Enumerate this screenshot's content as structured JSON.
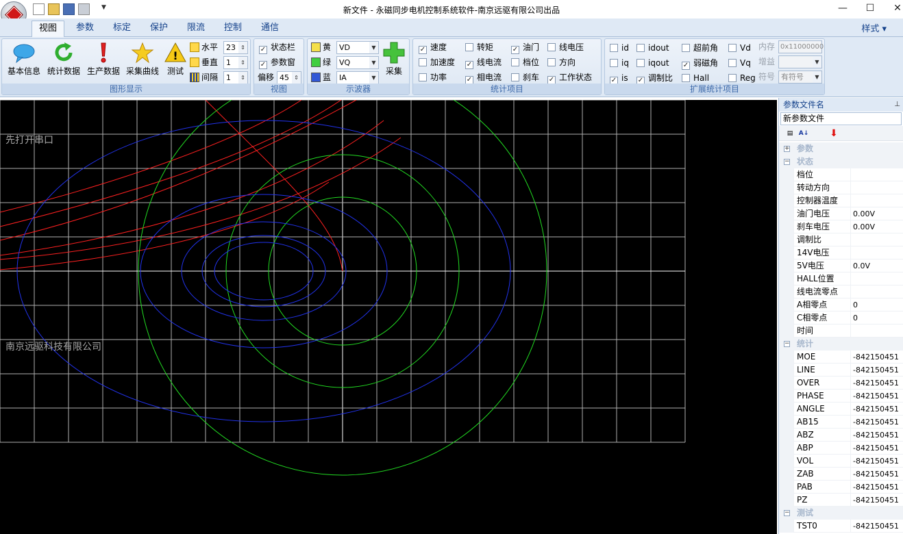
{
  "window": {
    "title": "新文件 - 永磁同步电机控制系统软件-南京远驱有限公司出品"
  },
  "tabs": [
    "视图",
    "参数",
    "标定",
    "保护",
    "限流",
    "控制",
    "通信"
  ],
  "style_menu": "样式",
  "groups": {
    "graph": {
      "label": "图形显示",
      "buttons": [
        "基本信息",
        "统计数据",
        "生产数据",
        "采集曲线",
        "测试"
      ],
      "spinners": [
        {
          "label": "水平",
          "value": "23"
        },
        {
          "label": "垂直",
          "value": "1"
        },
        {
          "label": "间隔",
          "value": "1"
        }
      ]
    },
    "view": {
      "label": "视图",
      "items": [
        {
          "label": "状态栏",
          "checked": true
        },
        {
          "label": "参数窗",
          "checked": true
        }
      ],
      "offset_label": "偏移",
      "offset_value": "45"
    },
    "scope": {
      "label": "示波器",
      "channels": [
        {
          "color_name": "黄",
          "color": "#f5e04a",
          "value": "VD"
        },
        {
          "color_name": "绿",
          "color": "#3fce3f",
          "value": "VQ"
        },
        {
          "color_name": "蓝",
          "color": "#3157d6",
          "value": "IA"
        }
      ],
      "capture_label": "采集"
    },
    "stats": {
      "label": "统计项目",
      "items": [
        {
          "label": "速度",
          "checked": true
        },
        {
          "label": "转矩",
          "checked": false
        },
        {
          "label": "油门",
          "checked": true
        },
        {
          "label": "线电压",
          "checked": false
        },
        {
          "label": "加速度",
          "checked": false
        },
        {
          "label": "线电流",
          "checked": true
        },
        {
          "label": "档位",
          "checked": false
        },
        {
          "label": "方向",
          "checked": false
        },
        {
          "label": "功率",
          "checked": false
        },
        {
          "label": "相电流",
          "checked": true
        },
        {
          "label": "刹车",
          "checked": false
        },
        {
          "label": "工作状态",
          "checked": true
        }
      ]
    },
    "ext": {
      "label": "扩展统计项目",
      "items": [
        {
          "label": "id",
          "checked": false
        },
        {
          "label": "idout",
          "checked": false
        },
        {
          "label": "超前角",
          "checked": false
        },
        {
          "label": "Vd",
          "checked": false
        },
        {
          "label": "iq",
          "checked": false
        },
        {
          "label": "iqout",
          "checked": false
        },
        {
          "label": "弱磁角",
          "checked": true
        },
        {
          "label": "Vq",
          "checked": false
        },
        {
          "label": "is",
          "checked": true
        },
        {
          "label": "调制比",
          "checked": true
        },
        {
          "label": "Hall",
          "checked": false
        },
        {
          "label": "Reg",
          "checked": false
        }
      ],
      "memory_label": "内存",
      "memory_value": "0x11000000",
      "gain_label": "增益",
      "gain_value": "",
      "sign_label": "符号",
      "sign_value": "有符号"
    }
  },
  "scope_view": {
    "text_top": "先打开串口",
    "text_bottom": "南京远驱科技有限公司",
    "trace_colors": {
      "red": "#ff2020",
      "green": "#22dd22",
      "blue": "#2233ee",
      "grid": "#b0b0b0",
      "axis": "#ffffff"
    }
  },
  "side_panel": {
    "title": "参数文件名",
    "file": "新参数文件",
    "categories": [
      {
        "name": "参数",
        "expanded": false,
        "rows": []
      },
      {
        "name": "状态",
        "expanded": true,
        "rows": [
          {
            "name": "档位",
            "value": ""
          },
          {
            "name": "转动方向",
            "value": ""
          },
          {
            "name": "控制器温度",
            "value": ""
          },
          {
            "name": "油门电压",
            "value": "0.00V"
          },
          {
            "name": "刹车电压",
            "value": "0.00V"
          },
          {
            "name": "调制比",
            "value": ""
          },
          {
            "name": "14V电压",
            "value": ""
          },
          {
            "name": "5V电压",
            "value": "0.0V"
          },
          {
            "name": "HALL位置",
            "value": ""
          },
          {
            "name": "线电流零点",
            "value": ""
          },
          {
            "name": "A相零点",
            "value": "0"
          },
          {
            "name": "C相零点",
            "value": "0"
          },
          {
            "name": "时间",
            "value": ""
          }
        ]
      },
      {
        "name": "统计",
        "expanded": true,
        "rows": [
          {
            "name": "MOE",
            "value": "-842150451"
          },
          {
            "name": "LINE",
            "value": "-842150451"
          },
          {
            "name": "OVER",
            "value": "-842150451"
          },
          {
            "name": "PHASE",
            "value": "-842150451"
          },
          {
            "name": "ANGLE",
            "value": "-842150451"
          },
          {
            "name": "AB15",
            "value": "-842150451"
          },
          {
            "name": "ABZ",
            "value": "-842150451"
          },
          {
            "name": "ABP",
            "value": "-842150451"
          },
          {
            "name": "VOL",
            "value": "-842150451"
          },
          {
            "name": "ZAB",
            "value": "-842150451"
          },
          {
            "name": "PAB",
            "value": "-842150451"
          },
          {
            "name": "PZ",
            "value": "-842150451"
          }
        ]
      },
      {
        "name": "测试",
        "expanded": true,
        "rows": [
          {
            "name": "TST0",
            "value": "-842150451"
          }
        ]
      }
    ]
  }
}
